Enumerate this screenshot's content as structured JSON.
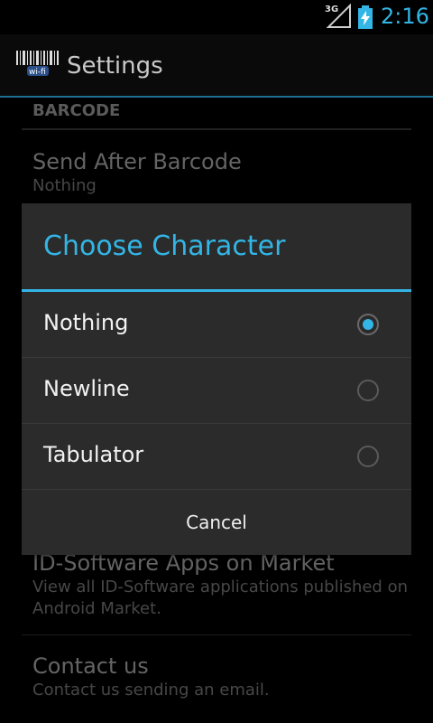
{
  "status_bar": {
    "network": "3G",
    "time": "2:16"
  },
  "action_bar": {
    "title": "Settings",
    "icon": "barcode-wifi-icon"
  },
  "preferences": {
    "category": "BARCODE",
    "items": [
      {
        "title": "Send After Barcode",
        "summary": "Nothing"
      },
      {
        "title": "ID-Software Apps on Market",
        "summary": "View all ID-Software applications published on Android Market."
      },
      {
        "title": "Contact us",
        "summary": "Contact us sending an email."
      }
    ]
  },
  "dialog": {
    "title": "Choose Character",
    "options": [
      {
        "label": "Nothing",
        "checked": true
      },
      {
        "label": "Newline",
        "checked": false
      },
      {
        "label": "Tabulator",
        "checked": false
      }
    ],
    "cancel_label": "Cancel"
  },
  "colors": {
    "accent": "#33b5e5",
    "dialog_bg": "#2b2b2b"
  }
}
